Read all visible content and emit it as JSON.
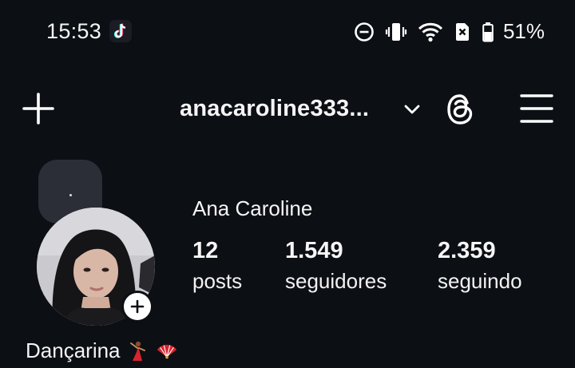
{
  "status_bar": {
    "time": "15:53",
    "battery_percent": "51%",
    "icons": [
      "tiktok-notification-icon",
      "do-not-disturb-icon",
      "vibrate-icon",
      "wifi-icon",
      "sim-off-icon",
      "battery-icon"
    ]
  },
  "header": {
    "username": "anacaroline333...",
    "icons": [
      "plus-icon",
      "chevron-down-icon",
      "threads-icon",
      "menu-icon"
    ]
  },
  "note": {
    "text": "."
  },
  "profile": {
    "name": "Ana Caroline",
    "stats": {
      "posts_count": "12",
      "posts_label": "posts",
      "followers_count": "1.549",
      "followers_label": "seguidores",
      "following_count": "2.359",
      "following_label": "seguindo"
    },
    "bio": "Dançarina"
  },
  "colors": {
    "background": "#0c0f14",
    "text": "#f5f5f5",
    "note_bubble": "#2b2e36"
  }
}
